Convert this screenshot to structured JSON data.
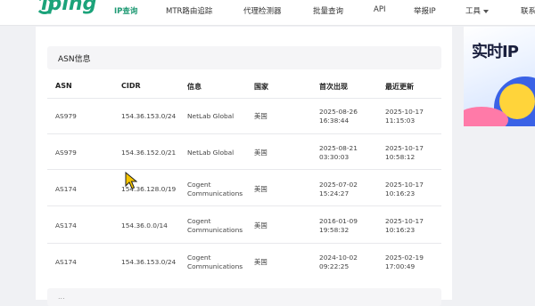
{
  "brand": {
    "logo_text": "iping"
  },
  "nav": [
    {
      "label": "IP查询",
      "active": true
    },
    {
      "label": "MTR路由追踪",
      "active": false
    },
    {
      "label": "代理检测器",
      "active": false
    },
    {
      "label": "批量查询",
      "active": false
    },
    {
      "label": "API",
      "active": false
    },
    {
      "label": "举报IP",
      "active": false
    },
    {
      "label": "工具",
      "active": false,
      "dropdown": true
    },
    {
      "label": "联系",
      "active": false
    }
  ],
  "asn_section": {
    "title": "ASN信息",
    "headers": [
      "ASN",
      "CIDR",
      "信息",
      "国家",
      "首次出现",
      "最近更新"
    ],
    "rows": [
      {
        "asn": "AS979",
        "cidr": "154.36.153.0/24",
        "info1": "NetLab Global",
        "info2": "",
        "country": "美国",
        "first1": "2025-08-26",
        "first2": "16:38:44",
        "last1": "2025-10-17",
        "last2": "11:15:03"
      },
      {
        "asn": "AS979",
        "cidr": "154.36.152.0/21",
        "info1": "NetLab Global",
        "info2": "",
        "country": "美国",
        "first1": "2025-08-21",
        "first2": "03:30:03",
        "last1": "2025-10-17",
        "last2": "10:58:12"
      },
      {
        "asn": "AS174",
        "cidr": "154.36.128.0/19",
        "info1": "Cogent",
        "info2": "Communications",
        "country": "美国",
        "first1": "2025-07-02",
        "first2": "15:24:27",
        "last1": "2025-10-17",
        "last2": "10:16:23"
      },
      {
        "asn": "AS174",
        "cidr": "154.36.0.0/14",
        "info1": "Cogent",
        "info2": "Communications",
        "country": "美国",
        "first1": "2016-01-09",
        "first2": "19:58:32",
        "last1": "2025-10-17",
        "last2": "10:16:23"
      },
      {
        "asn": "AS174",
        "cidr": "154.36.153.0/24",
        "info1": "Cogent",
        "info2": "Communications",
        "country": "美国",
        "first1": "2024-10-02",
        "first2": "09:22:25",
        "last1": "2025-02-19",
        "last2": "17:00:49"
      }
    ]
  },
  "next_section": {
    "title": "..."
  },
  "ad": {
    "text": "实时IP"
  },
  "colors": {
    "accent": "#1f9a74",
    "brand": "#1ba37a"
  }
}
